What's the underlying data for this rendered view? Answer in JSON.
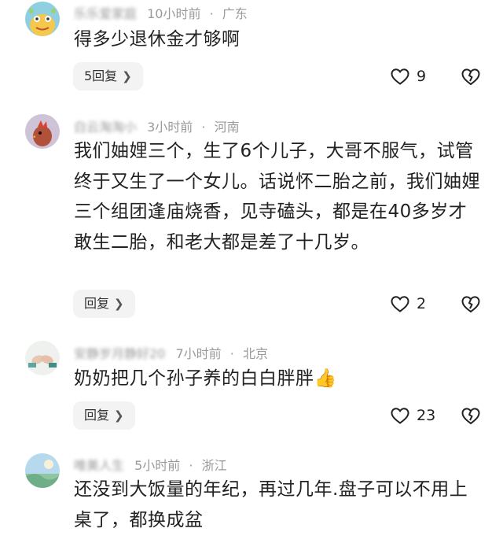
{
  "comments": [
    {
      "name": "乐乐爱家庭",
      "time": "10小时前",
      "location": "广东",
      "text": "得多少退休金才够啊",
      "reply_label": "5回复",
      "likes": "9"
    },
    {
      "name": "白云淘淘小",
      "time": "3小时前",
      "location": "河南",
      "text": "我们妯娌三个，生了6个儿子，大哥不服气，试管终于又生了一个女儿。话说怀二胎之前，我们妯娌三个组团逢庙烧香，见寺磕头，都是在40多岁才敢生二胎，和老大都是差了十几岁。",
      "reply_label": "回复",
      "likes": "2"
    },
    {
      "name": "安静岁月静好20",
      "time": "7小时前",
      "location": "北京",
      "text": "奶奶把几个孙子养的白白胖胖👍",
      "reply_label": "回复",
      "likes": "23"
    },
    {
      "name": "唯美人生",
      "time": "5小时前",
      "location": "浙江",
      "text": "还没到大饭量的年纪，再过几年.盘子可以不用上桌了，都换成盆"
    }
  ],
  "separator": "·",
  "colors": {
    "meta": "#9a9a9a",
    "reply_bg": "#f3f3f3",
    "text": "#222222"
  },
  "icons": {
    "like": "heart-outline-icon",
    "dislike": "broken-heart-icon",
    "reply_chevron": "chevron-right-icon"
  }
}
